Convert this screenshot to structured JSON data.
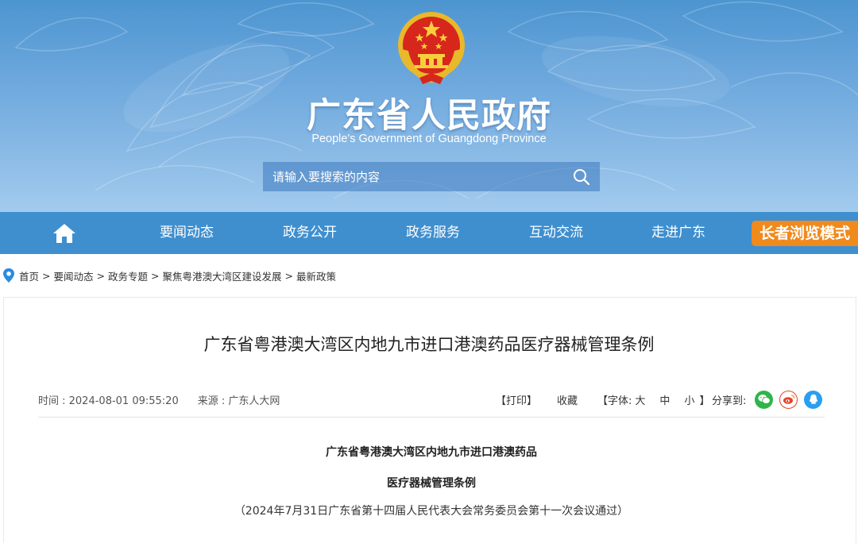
{
  "header": {
    "site_title": "广东省人民政府",
    "site_subtitle": "People's Government of Guangdong Province",
    "search_placeholder": "请输入要搜索的内容"
  },
  "nav": {
    "items": [
      "要闻动态",
      "政务公开",
      "政务服务",
      "互动交流",
      "走进广东"
    ],
    "elder_mode": "长者浏览模式"
  },
  "breadcrumb": [
    "首页",
    "要闻动态",
    "政务专题",
    "聚焦粤港澳大湾区建设发展",
    "最新政策"
  ],
  "article": {
    "title": "广东省粤港澳大湾区内地九市进口港澳药品医疗器械管理条例",
    "time": "时间 : 2024-08-01 09:55:20",
    "source": "来源 : 广东人大网",
    "print": "【打印】",
    "favorite": "收藏",
    "font_label": "【字体:",
    "font_large": "大",
    "font_medium": "中",
    "font_small": "小",
    "font_close": "】",
    "share_label": "分享到:",
    "doc_title_line1": "广东省粤港澳大湾区内地九市进口港澳药品",
    "doc_title_line2": "医疗器械管理条例",
    "doc_note": "（2024年7月31日广东省第十四届人民代表大会常务委员会第十一次会议通过）"
  },
  "colors": {
    "nav_blue": "#3f8fcf",
    "elder_orange": "#f08a1c",
    "wechat_green": "#2fb54a",
    "weibo_red": "#e6432a",
    "qq_blue": "#2a9ff0"
  }
}
